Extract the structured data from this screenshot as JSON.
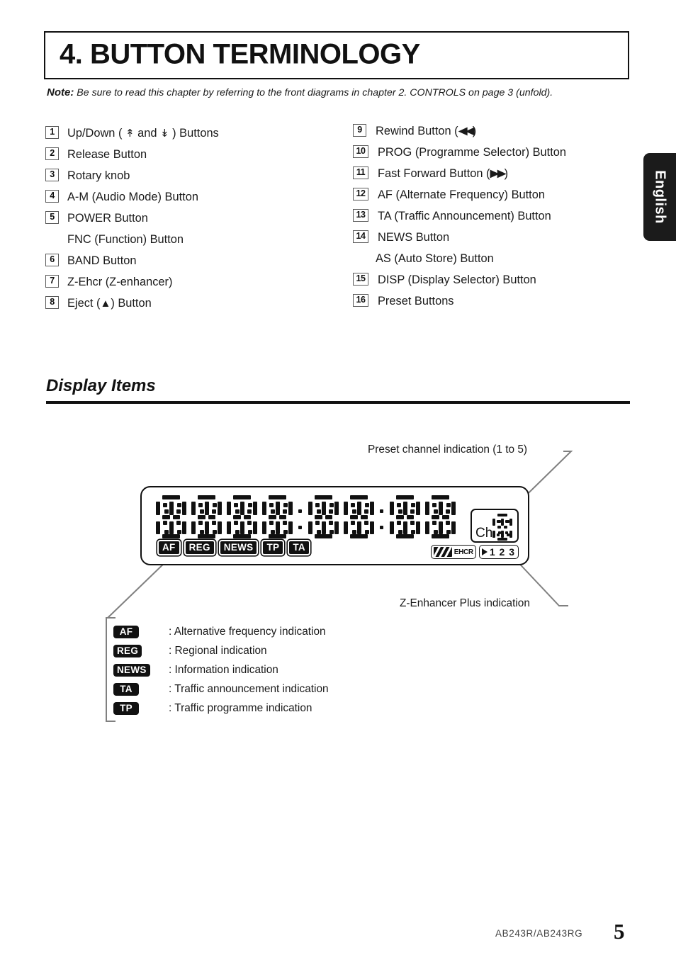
{
  "chapter": {
    "title": "4. BUTTON TERMINOLOGY",
    "note_label": "Note:",
    "note_text": "Be sure to read this chapter by referring to the front diagrams in chapter 2. CONTROLS on page 3 (unfold)."
  },
  "buttons_left": [
    {
      "num": "1",
      "pre": "Up/Down ( ",
      "up": "»",
      "mid": " and ",
      "down": "»",
      "post": " ) Buttons",
      "has_glyphs": true
    },
    {
      "num": "2",
      "text": "Release Button"
    },
    {
      "num": "3",
      "text": "Rotary knob"
    },
    {
      "num": "4",
      "text": "A-M (Audio Mode) Button"
    },
    {
      "num": "5",
      "text": "POWER Button"
    },
    {
      "num": "",
      "text": "FNC (Function) Button"
    },
    {
      "num": "6",
      "text": "BAND Button"
    },
    {
      "num": "7",
      "text": "Z-Ehcr (Z-enhancer)"
    },
    {
      "num": "8",
      "pre": "Eject (",
      "glyph": "▲",
      "post": ") Button",
      "has_eject": true
    }
  ],
  "buttons_right": [
    {
      "num": "9",
      "pre": "Rewind Button (",
      "glyph": "◀◀",
      "post": ")",
      "has_arrows": true
    },
    {
      "num": "10",
      "text": "PROG (Programme Selector) Button"
    },
    {
      "num": "11",
      "pre": "Fast Forward Button (",
      "glyph": "▶▶",
      "post": ")",
      "has_arrows": true
    },
    {
      "num": "12",
      "text": "AF (Alternate Frequency) Button"
    },
    {
      "num": "13",
      "text": "TA (Traffic Announcement) Button"
    },
    {
      "num": "14",
      "text": "NEWS Button"
    },
    {
      "num": "",
      "text": "AS (Auto Store) Button"
    },
    {
      "num": "15",
      "text": "DISP (Display Selector) Button"
    },
    {
      "num": "16",
      "text": "Preset Buttons"
    }
  ],
  "display_section": {
    "heading": "Display Items",
    "callout_preset": "Preset channel indication (1 to 5)",
    "callout_zenhancer": "Z-Enhancer Plus indication"
  },
  "lcd": {
    "indicators": [
      "AF",
      "REG",
      "NEWS",
      "TP",
      "TA"
    ],
    "ch_label": "Ch",
    "zehcr_label": "EHCR",
    "preset_numbers": "1 2 3",
    "character_count": 8
  },
  "legend": [
    {
      "badge": "AF",
      "text": ": Alternative frequency indication"
    },
    {
      "badge": "REG",
      "text": ": Regional indication"
    },
    {
      "badge": "NEWS",
      "text": ": Information indication"
    },
    {
      "badge": "TA",
      "text": ": Traffic announcement indication"
    },
    {
      "badge": "TP",
      "text": ": Traffic programme indication"
    }
  ],
  "side_tab": {
    "label": "English"
  },
  "footer": {
    "model": "AB243R/AB243RG",
    "page": "5"
  },
  "colors": {
    "ink": "#111111",
    "callout_line": "#808080",
    "tab_bg": "#1b1b1b"
  }
}
